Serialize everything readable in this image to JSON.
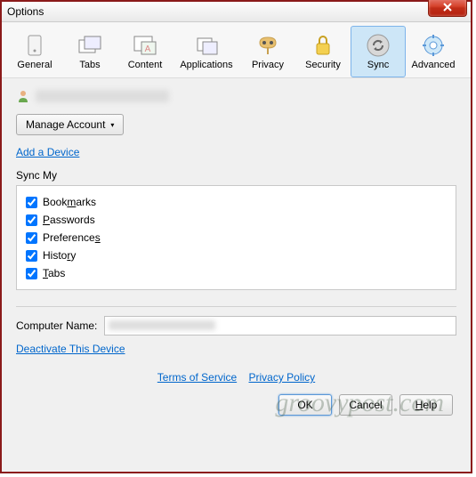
{
  "window": {
    "title": "Options"
  },
  "toolbar": {
    "general": "General",
    "tabs": "Tabs",
    "content": "Content",
    "applications": "Applications",
    "privacy": "Privacy",
    "security": "Security",
    "sync": "Sync",
    "advanced": "Advanced",
    "active": "sync"
  },
  "account": {
    "manage_label": "Manage Account",
    "add_device_link": "Add a Device"
  },
  "sync": {
    "section_label": "Sync My",
    "items": [
      {
        "label": "Bookmarks",
        "checked": true,
        "key": "m"
      },
      {
        "label": "Passwords",
        "checked": true,
        "key": "P"
      },
      {
        "label": "Preferences",
        "checked": true,
        "key": "s"
      },
      {
        "label": "History",
        "checked": true,
        "key": "r"
      },
      {
        "label": "Tabs",
        "checked": true,
        "key": "T"
      }
    ]
  },
  "device": {
    "computer_name_label": "Computer Name:",
    "deactivate_link": "Deactivate This Device"
  },
  "footer": {
    "tos": "Terms of Service",
    "privacy": "Privacy Policy",
    "ok": "OK",
    "cancel": "Cancel",
    "help": "Help"
  },
  "watermark": "groovypost.com"
}
